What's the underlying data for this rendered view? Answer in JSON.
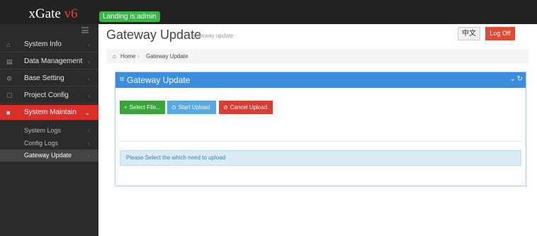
{
  "app": {
    "logo_name": "xGate",
    "logo_version": "v6",
    "landing_badge": "Landing is:admin"
  },
  "sidebar": {
    "items": [
      {
        "icon": "home-icon",
        "label": "System Info"
      },
      {
        "icon": "chart-icon",
        "label": "Data Management"
      },
      {
        "icon": "cogs-icon",
        "label": "Base Setting"
      },
      {
        "icon": "tablet-icon",
        "label": "Project Config"
      },
      {
        "icon": "briefcase-icon",
        "label": "System Maintain"
      }
    ],
    "subitems": [
      {
        "label": "System Logs"
      },
      {
        "label": "Config Logs"
      },
      {
        "label": "Gateway Update"
      }
    ]
  },
  "header": {
    "title": "Gateway Update",
    "subtitle": "gateway update",
    "lang_button": "中文",
    "logoff_button": "Log Off"
  },
  "breadcrumb": {
    "home": "Home",
    "current": "Gateway Update"
  },
  "panel": {
    "title": "Gateway Update",
    "buttons": {
      "select": "Select File...",
      "start": "Start Upload",
      "cancel": "Cancel Upload"
    },
    "info": "Please Select the which need to upload"
  },
  "colors": {
    "topbar": "#222222",
    "sidebar": "#2b2b2b",
    "active": "#d9302c",
    "panel_header": "#3c8dde",
    "success": "#3aa33a",
    "danger": "#d73d31"
  }
}
